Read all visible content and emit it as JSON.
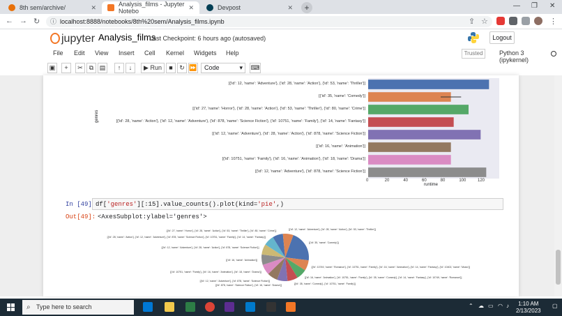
{
  "browser": {
    "tabs": [
      {
        "title": "8th sem/archive/",
        "color": "#e8710a"
      },
      {
        "title": "Analysis_films - Jupyter Notebo",
        "color": "#f37726"
      },
      {
        "title": "Devpost",
        "color": "#003e54"
      }
    ],
    "url": "localhost:8888/notebooks/8th%20sem/Analysis_films.ipynb"
  },
  "jupyter": {
    "logo_text": "jupyter",
    "notebook_name": "Analysis_films",
    "checkpoint": "Last Checkpoint: 6 hours ago",
    "autosaved": "(autosaved)",
    "logout": "Logout",
    "menus": [
      "File",
      "Edit",
      "View",
      "Insert",
      "Cell",
      "Kernel",
      "Widgets",
      "Help"
    ],
    "trusted": "Trusted",
    "kernel": "Python 3 (ipykernel)",
    "toolbar": {
      "run": "Run",
      "cell_type": "Code"
    }
  },
  "bar_chart": {
    "ylabel": "genres",
    "xlabel": "runtime",
    "xticks": [
      "0",
      "20",
      "40",
      "60",
      "80",
      "100",
      "120"
    ],
    "bars": [
      {
        "label": "[{'id': 12, 'name': 'Adventure'}, {'id': 28, 'name': 'Action'}, {'id': 53, 'name': 'Thriller'}]",
        "value": 130,
        "color": "#4c72b0"
      },
      {
        "label": "[{'id': 35, 'name': 'Comedy'}]",
        "value": 89,
        "color": "#dd8452"
      },
      {
        "label": "[{'id': 27, 'name': 'Horror'}, {'id': 28, 'name': 'Action'}, {'id': 53, 'name': 'Thriller'}, {'id': 80, 'name': 'Crime'}]",
        "value": 108,
        "color": "#55a868"
      },
      {
        "label": "[{'id': 28, 'name': 'Action'}, {'id': 12, 'name': 'Adventure'}, {'id': 878, 'name': 'Science Fiction'}, {'id': 10751, 'name': 'Family'}, {'id': 14, 'name': 'Fantasy'}]",
        "value": 92,
        "color": "#c44e52"
      },
      {
        "label": "[{'id': 12, 'name': 'Adventure'}, {'id': 28, 'name': 'Action'}, {'id': 878, 'name': 'Science Fiction'}]",
        "value": 121,
        "color": "#8172b3"
      },
      {
        "label": "[{'id': 16, 'name': 'Animation'}]",
        "value": 89,
        "color": "#937860"
      },
      {
        "label": "[{'id': 10751, 'name': 'Family'}, {'id': 16, 'name': 'Animation'}, {'id': 18, 'name': 'Drama'}]",
        "value": 89,
        "color": "#da8bc3"
      },
      {
        "label": "[{'id': 12, 'name': 'Adventure'}, {'id': 878, 'name': 'Science Fiction'}]",
        "value": 127,
        "color": "#8c8c8c"
      }
    ]
  },
  "cell49": {
    "in_prompt": "In [49]:",
    "code_prefix": "df[",
    "code_str1": "'genres'",
    "code_mid": "][:15].value_counts().plot(kind=",
    "code_str2": "'pie'",
    "code_suffix": ",)",
    "out_prompt": "Out[49]:",
    "out_text": "<AxesSubplot:ylabel='genres'>"
  },
  "pie_chart": {
    "slices": [
      {
        "value": 3,
        "color": "#4c72b0",
        "label": "[{'id': 35, 'name': 'Comedy'}]"
      },
      {
        "value": 1,
        "color": "#dd8452",
        "label": "[{'id': 10749, 'name': 'Romance'}, {'id': 10751, 'name': 'Family'}, {'id': 16, 'name': 'Animation'}, {'id': 14, 'name': 'Fantasy'}, {'id': 10402, 'name': 'Music'}]"
      },
      {
        "value": 1,
        "color": "#55a868",
        "label": "[{'id': 16, 'name': 'Animation'}, {'id': 10751, 'name': 'Family'}, {'id': 35, 'name': 'Comedy'}, {'id': 14, 'name': 'Fantasy'}, {'id': 10749, 'name': 'Romance'}]"
      },
      {
        "value": 1,
        "color": "#c44e52",
        "label": "[{'id': 35, 'name': 'Comedy'}, {'id': 10751, 'name': 'Family'}]"
      },
      {
        "value": 1,
        "color": "#8172b3",
        "label": "[{'id': 878, 'name': 'Science Fiction'}, {'id': 16, 'name': 'Drama'}]"
      },
      {
        "value": 1,
        "color": "#937860",
        "label": "[{'id': 12, 'name': 'Adventure'}, {'id': 878, 'name': 'Science Fiction'}]"
      },
      {
        "value": 1,
        "color": "#da8bc3",
        "label": "[{'id': 10751, 'name': 'Family'}, {'id': 16, 'name': 'Animation'}, {'id': 18, 'name': 'Drama'}]"
      },
      {
        "value": 1,
        "color": "#8c8c8c",
        "label": "[{'id': 16, 'name': 'Animation'}]"
      },
      {
        "value": 1,
        "color": "#ccb974",
        "label": "[{'id': 12, 'name': 'Adventure'}, {'id': 28, 'name': 'Action'}, {'id': 878, 'name': 'Science Fiction'}]"
      },
      {
        "value": 1,
        "color": "#64b5cd",
        "label": "[{'id': 28, 'name': 'Action'}, {'id': 12, 'name': 'Adventure'}, {'id': 878, 'name': 'Science Fiction'}, {'id': 10751, 'name': 'Family'}, {'id': 14, 'name': 'Fantasy'}]"
      },
      {
        "value": 1,
        "color": "#4c72b0",
        "label": "[{'id': 27, 'name': 'Horror'}, {'id': 28, 'name': 'Action'}, {'id': 53, 'name': 'Thriller'}, {'id': 80, 'name': 'Crime'}]"
      },
      {
        "value": 1,
        "color": "#dd8452",
        "label": "[{'id': 12, 'name': 'Adventure'}, {'id': 28, 'name': 'Action'}, {'id': 53, 'name': 'Thriller'}]"
      }
    ]
  },
  "taskbar": {
    "search": "Type here to search",
    "time": "1:10 AM",
    "date": "2/13/2023"
  },
  "chart_data": {
    "type": "bar",
    "categories": [
      "[{'id': 12, 'name': 'Adventure'}, {'id': 28, 'name': 'Action'}, {'id': 53, 'name': 'Thriller'}]",
      "[{'id': 35, 'name': 'Comedy'}]",
      "[{'id': 27, 'name': 'Horror'}, {'id': 28, 'name': 'Action'}, {'id': 53, 'name': 'Thriller'}, {'id': 80, 'name': 'Crime'}]",
      "[{'id': 28, 'name': 'Action'}, {'id': 12, 'name': 'Adventure'}, {'id': 878, 'name': 'Science Fiction'}, {'id': 10751, 'name': 'Family'}, {'id': 14, 'name': 'Fantasy'}]",
      "[{'id': 12, 'name': 'Adventure'}, {'id': 28, 'name': 'Action'}, {'id': 878, 'name': 'Science Fiction'}]",
      "[{'id': 16, 'name': 'Animation'}]",
      "[{'id': 10751, 'name': 'Family'}, {'id': 16, 'name': 'Animation'}, {'id': 18, 'name': 'Drama'}]",
      "[{'id': 12, 'name': 'Adventure'}, {'id': 878, 'name': 'Science Fiction'}]"
    ],
    "values": [
      130,
      89,
      108,
      92,
      121,
      89,
      89,
      127
    ],
    "xlabel": "runtime",
    "ylabel": "genres",
    "xlim": [
      0,
      135
    ]
  }
}
